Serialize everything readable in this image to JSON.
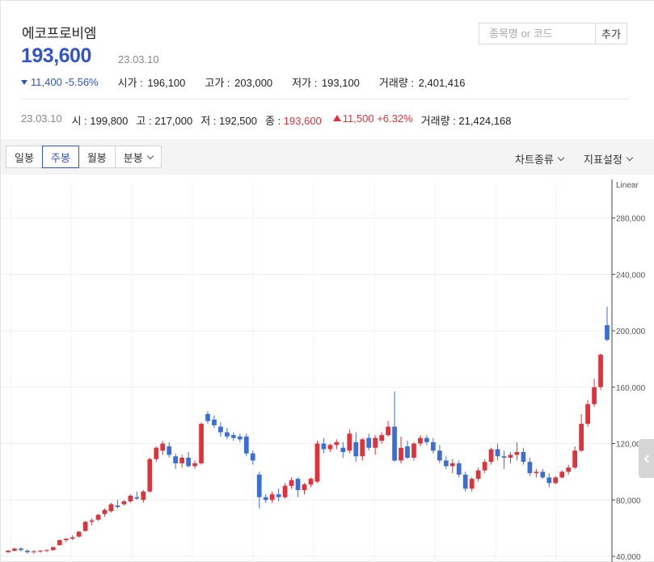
{
  "header": {
    "stock_name": "에코프로비엠",
    "price": "193,600",
    "price_date": "23.03.10",
    "change": "11,400",
    "change_pct": "-5.56%",
    "stats": [
      {
        "label": "시가 : ",
        "value": "196,100"
      },
      {
        "label": "고가 : ",
        "value": "203,000"
      },
      {
        "label": "저가 : ",
        "value": "193,100"
      },
      {
        "label": "거래량 : ",
        "value": "2,401,416"
      }
    ]
  },
  "search": {
    "placeholder": "종목명 or 코드",
    "button_label": "추가"
  },
  "daily": {
    "date": "23.03.10",
    "open": "시 : 199,800",
    "high": "고 : 217,000",
    "low": "저 : 192,500",
    "close_label": "종 : ",
    "close_value": "193,600",
    "change": "11,500",
    "change_pct": "+6.32%",
    "volume": "거래량 : 21,424,168"
  },
  "toolbar": {
    "periods": [
      "일봉",
      "주봉",
      "월봉",
      "분봉"
    ],
    "active_period": "주봉",
    "chart_type_label": "차트종류",
    "indicator_label": "지표설정"
  },
  "colors": {
    "up": "#e0323b",
    "down": "#3b6fd6",
    "accent": "#3155c9"
  },
  "chart_data": {
    "type": "candlestick",
    "scale_label": "Linear",
    "ylim": [
      36000,
      305000
    ],
    "yticks": [
      40000,
      80000,
      120000,
      160000,
      200000,
      240000,
      280000
    ],
    "ytick_labels": [
      "40,000",
      "80,000",
      "120,000",
      "160,000",
      "200,000",
      "240,000",
      "280,000"
    ],
    "grid": true,
    "candles": [
      [
        43000,
        44500,
        42500,
        44000
      ],
      [
        44000,
        46000,
        43500,
        45500
      ],
      [
        45500,
        46500,
        43500,
        44500
      ],
      [
        44000,
        45000,
        42000,
        43000
      ],
      [
        43000,
        44500,
        42000,
        43500
      ],
      [
        43500,
        44500,
        42500,
        44000
      ],
      [
        44000,
        45000,
        43000,
        44500
      ],
      [
        44500,
        47000,
        44000,
        46500
      ],
      [
        48000,
        52000,
        47500,
        51500
      ],
      [
        51500,
        53000,
        50000,
        52500
      ],
      [
        52500,
        55000,
        51500,
        53500
      ],
      [
        54000,
        58000,
        53500,
        57500
      ],
      [
        58000,
        65000,
        57500,
        64500
      ],
      [
        64500,
        67000,
        62000,
        65500
      ],
      [
        66000,
        70000,
        65000,
        69500
      ],
      [
        70000,
        74000,
        68000,
        73000
      ],
      [
        72000,
        78000,
        71000,
        77000
      ],
      [
        76000,
        80000,
        74000,
        75000
      ],
      [
        77000,
        80000,
        76000,
        79000
      ],
      [
        79000,
        84000,
        78000,
        83000
      ],
      [
        82000,
        86000,
        80000,
        81000
      ],
      [
        80000,
        87000,
        78000,
        86000
      ],
      [
        86000,
        110000,
        85000,
        109000
      ],
      [
        109000,
        118000,
        107000,
        117000
      ],
      [
        115000,
        122000,
        112000,
        120000
      ],
      [
        118000,
        121000,
        110000,
        112000
      ],
      [
        111000,
        113000,
        102000,
        106000
      ],
      [
        106000,
        112000,
        103000,
        110000
      ],
      [
        110000,
        114000,
        103000,
        104000
      ],
      [
        104000,
        108000,
        102000,
        106000
      ],
      [
        106000,
        135000,
        105000,
        134000
      ],
      [
        141000,
        143000,
        134000,
        136000
      ],
      [
        137000,
        140000,
        131000,
        133000
      ],
      [
        132000,
        135000,
        125000,
        128000
      ],
      [
        128000,
        131000,
        123000,
        125000
      ],
      [
        126000,
        128000,
        122000,
        124000
      ],
      [
        125000,
        127000,
        121000,
        123000
      ],
      [
        125000,
        127000,
        111000,
        113000
      ],
      [
        113000,
        115000,
        105000,
        108000
      ],
      [
        98000,
        100000,
        74000,
        82000
      ],
      [
        82000,
        84000,
        78000,
        80000
      ],
      [
        80000,
        86000,
        78000,
        84000
      ],
      [
        84000,
        88000,
        79000,
        82000
      ],
      [
        82000,
        92000,
        81000,
        90000
      ],
      [
        90000,
        96000,
        88000,
        94000
      ],
      [
        95000,
        96000,
        82000,
        87000
      ],
      [
        87000,
        92000,
        84000,
        91000
      ],
      [
        91000,
        96000,
        89000,
        95000
      ],
      [
        93000,
        122000,
        92000,
        120000
      ],
      [
        120000,
        124000,
        113000,
        116000
      ],
      [
        116000,
        120000,
        114000,
        119000
      ],
      [
        119000,
        123000,
        116000,
        121000
      ],
      [
        117000,
        121000,
        110000,
        114000
      ],
      [
        115000,
        130000,
        113000,
        127000
      ],
      [
        121000,
        128000,
        107000,
        111000
      ],
      [
        111000,
        124000,
        108000,
        123000
      ],
      [
        124000,
        127000,
        115000,
        117000
      ],
      [
        117000,
        126000,
        112000,
        124000
      ],
      [
        122000,
        128000,
        120000,
        126000
      ],
      [
        126000,
        136000,
        125000,
        132000
      ],
      [
        132000,
        157000,
        107000,
        108000
      ],
      [
        108000,
        125000,
        106000,
        117000
      ],
      [
        118000,
        122000,
        109000,
        110000
      ],
      [
        110000,
        121000,
        108000,
        120000
      ],
      [
        120000,
        126000,
        118000,
        124000
      ],
      [
        124000,
        126000,
        119000,
        121000
      ],
      [
        121000,
        124000,
        113000,
        115000
      ],
      [
        115000,
        119000,
        106000,
        108000
      ],
      [
        108000,
        111000,
        102000,
        104000
      ],
      [
        104000,
        109000,
        99000,
        106000
      ],
      [
        106000,
        108000,
        96000,
        98000
      ],
      [
        98000,
        100000,
        86000,
        88000
      ],
      [
        88000,
        96000,
        86000,
        95000
      ],
      [
        95000,
        103000,
        93000,
        101000
      ],
      [
        101000,
        109000,
        99000,
        107000
      ],
      [
        107000,
        117000,
        105000,
        116000
      ],
      [
        116000,
        120000,
        108000,
        111000
      ],
      [
        111000,
        115000,
        102000,
        110000
      ],
      [
        110000,
        114000,
        106000,
        112000
      ],
      [
        112000,
        121000,
        108000,
        114000
      ],
      [
        114000,
        117000,
        105000,
        107000
      ],
      [
        107000,
        110000,
        97000,
        99000
      ],
      [
        99000,
        102000,
        96000,
        100000
      ],
      [
        100000,
        102000,
        95000,
        96000
      ],
      [
        96000,
        99000,
        89000,
        92000
      ],
      [
        92000,
        97000,
        91000,
        96000
      ],
      [
        96000,
        101000,
        95000,
        100000
      ],
      [
        100000,
        105000,
        98000,
        103000
      ],
      [
        103000,
        118000,
        102000,
        115000
      ],
      [
        115000,
        141000,
        114000,
        134000
      ],
      [
        134000,
        151000,
        132000,
        148000
      ],
      [
        148000,
        166000,
        146000,
        160000
      ],
      [
        160000,
        184000,
        158000,
        183000
      ],
      [
        204000,
        217000,
        192500,
        193600
      ]
    ]
  }
}
